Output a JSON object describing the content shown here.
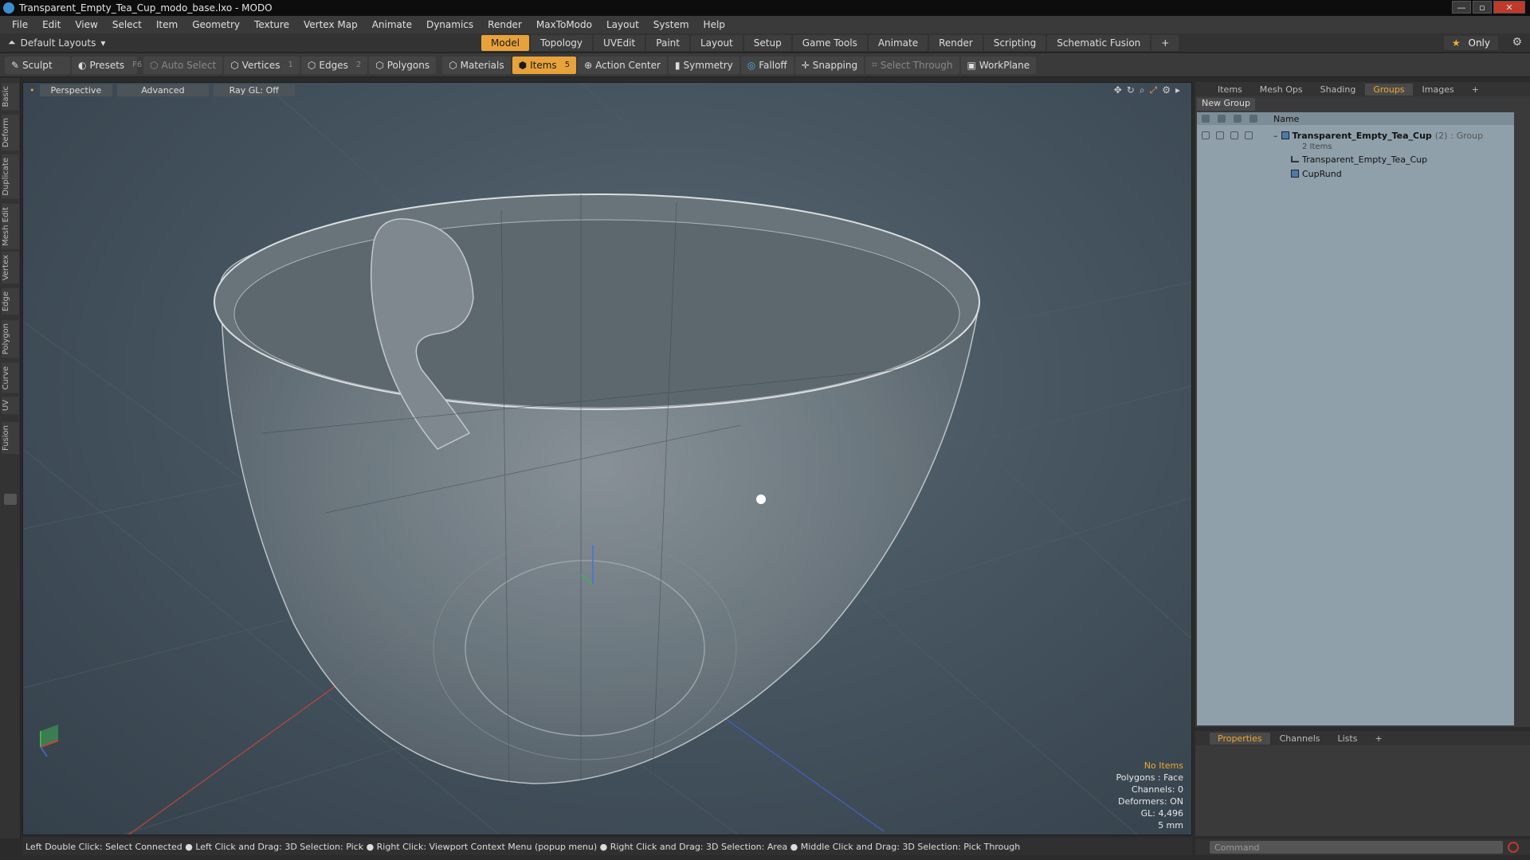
{
  "window": {
    "title": "Transparent_Empty_Tea_Cup_modo_base.lxo - MODO"
  },
  "menu": [
    "File",
    "Edit",
    "View",
    "Select",
    "Item",
    "Geometry",
    "Texture",
    "Vertex Map",
    "Animate",
    "Dynamics",
    "Render",
    "MaxToModo",
    "Layout",
    "System",
    "Help"
  ],
  "layout": {
    "selector": "Default Layouts",
    "tabs": [
      "Model",
      "Topology",
      "UVEdit",
      "Paint",
      "Layout",
      "Setup",
      "Game Tools",
      "Animate",
      "Render",
      "Scripting",
      "Schematic Fusion"
    ],
    "active_tab": "Model",
    "only_label": "Only"
  },
  "toolbar": {
    "sculpt": "Sculpt",
    "presets": "Presets",
    "presets_key": "F6",
    "auto_select": "Auto Select",
    "vertices": "Vertices",
    "vertices_num": "1",
    "edges": "Edges",
    "edges_num": "2",
    "polygons": "Polygons",
    "materials": "Materials",
    "items": "Items",
    "items_num": "5",
    "action_center": "Action Center",
    "symmetry": "Symmetry",
    "falloff": "Falloff",
    "snapping": "Snapping",
    "select_through": "Select Through",
    "workplane": "WorkPlane"
  },
  "left_tabs": [
    "Basic",
    "Deform",
    "Duplicate",
    "Mesh Edit",
    "Vertex",
    "Edge",
    "Polygon",
    "Curve",
    "UV",
    "Fusion"
  ],
  "viewport": {
    "view": "Perspective",
    "shading": "Advanced",
    "raygl": "Ray GL: Off",
    "stats": {
      "no_items": "No Items",
      "polygons": "Polygons : Face",
      "channels": "Channels: 0",
      "deformers": "Deformers: ON",
      "gl": "GL: 4,496",
      "scale": "5 mm"
    }
  },
  "status_hint": "Left Double Click: Select Connected ● Left Click and Drag: 3D Selection: Pick ● Right Click: Viewport Context Menu (popup menu) ● Right Click and Drag: 3D Selection: Area ● Middle Click and Drag: 3D Selection: Pick Through",
  "right_panel": {
    "tabs": [
      "Items",
      "Mesh Ops",
      "Shading",
      "Groups",
      "Images"
    ],
    "active_tab": "Groups",
    "new_group": "New Group",
    "column_name": "Name",
    "group": {
      "name": "Transparent_Empty_Tea_Cup",
      "count": "(2)",
      "type": ": Group",
      "sub": "2 Items"
    },
    "children": [
      "Transparent_Empty_Tea_Cup",
      "CupRund"
    ]
  },
  "bottom_panel": {
    "tabs": [
      "Properties",
      "Channels",
      "Lists"
    ],
    "active_tab": "Properties",
    "command_placeholder": "Command"
  },
  "colors": {
    "accent": "#e8a23a",
    "list_bg": "#8fa0ab"
  }
}
